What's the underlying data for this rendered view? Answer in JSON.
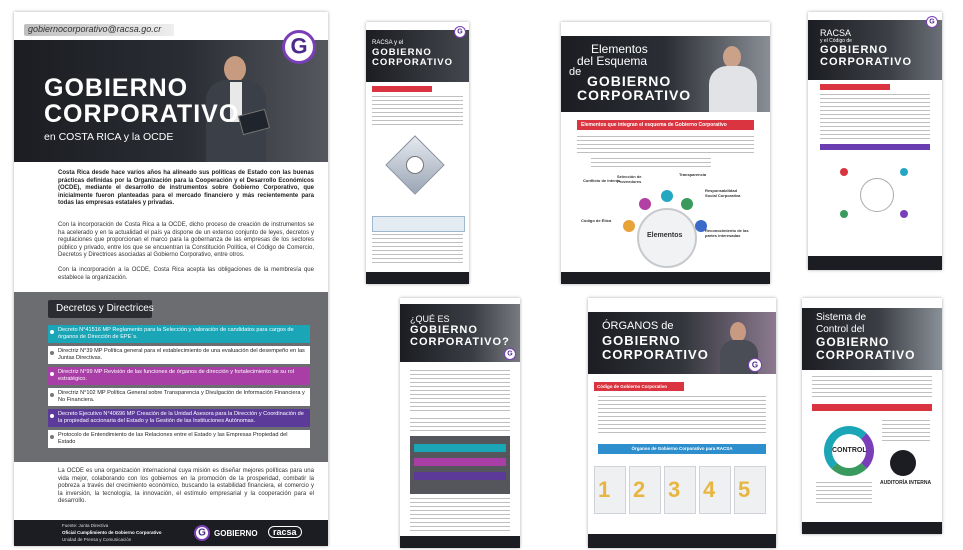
{
  "main_infographic": {
    "email": "gobiernocorporativo@racsa.go.cr",
    "logo_letter": "G",
    "title_line1": "GOBIERNO",
    "title_line2": "CORPORATIVO",
    "subtitle": "en COSTA RICA y la OCDE",
    "intro_bold": "Costa Rica desde hace varios años ha alineado sus políticas de Estado con las buenas prácticas definidas por la Organización para la Cooperación y el Desarrollo Económicos (OCDE), mediante el desarrollo de instrumentos sobre Gobierno Corporativo, que inicialmente fueron planteadas para el mercado financiero y más recientemente para todas las empresas estatales y privadas.",
    "para2": "Con la incorporación de Costa Rica a la OCDE, dicho proceso de creación de instrumentos se ha acelerado y en la actualidad el país ya dispone de un extenso conjunto de leyes, decretos y regulaciones que proporcionan el marco para la gobernanza de las empresas de los sectores público y privado, entre los que se encuentran la Constitución Política, el Código de Comercio, Decretos y Directrices asociadas al Gobierno Corporativo, entre otros.",
    "para3": "Con la incorporación a la OCDE, Costa Rica acepta las obligaciones de la membresía que establece la organización.",
    "section_title": "Decretos y Directrices",
    "decrees": [
      {
        "text": "Decreto N°41516 MP Reglamento para la Selección y valoración de candidatos para cargos de órganos de Dirección de EPE´s.",
        "color": "#1aa6b7"
      },
      {
        "text": "Directriz N°39 MP Política general para el establecimiento de una evaluación del desempeño en las Juntas Directivas.",
        "color": "#ffffff"
      },
      {
        "text": "Directriz N°99 MP Revisión de las funciones de órganos de dirección y fortalecimiento de su rol estratégico.",
        "color": "#a83ea6"
      },
      {
        "text": "Directriz N°102 MP Política General sobre Transparencia y Divulgación de Información Financiera y No Financiera.",
        "color": "#ffffff"
      },
      {
        "text": "Decreto Ejecutivo N°40696 MP Creación de la Unidad Asesora para la Dirección y Coordinación de la propiedad accionaria del Estado y la Gestión de las Instituciones Autónomas.",
        "color": "#5b3a9a"
      },
      {
        "text": "Protocolo de Entendimiento de las Relaciones entre el Estado y las Empresas Propiedad del Estado",
        "color": "#ffffff"
      }
    ],
    "closing": "La OCDE es una organización internacional cuya misión es diseñar mejores políticas para una vida mejor, colaborando con los gobiernos en la promoción de la prosperidad, combatir la pobreza a través del crecimiento económico, buscando la estabilidad financiera, el comercio y la inversión, la tecnología, la innovación, el estímulo empresarial y la cooperación para el desarrollo.",
    "footer_line1": "Fuente: Junta Directiva",
    "footer_line2": "Oficial Cumplimiento de Gobierno Corporativo",
    "footer_line3": "Unidad de Prensa y Comunicación",
    "footer_brand": "GOBIERNO",
    "footer_racsa": "racsa"
  },
  "thumb_racsa_code": {
    "title_small": "RACSA y el",
    "title_line1": "GOBIERNO",
    "title_line2": "CORPORATIVO"
  },
  "thumb_elements": {
    "title_line1": "Elementos",
    "title_line2": "del Esquema",
    "title_line3": "de",
    "title_line4": "GOBIERNO",
    "title_line5": "CORPORATIVO",
    "band": "Elementos que integran el esquema de Gobierno Corporativo",
    "center_label": "Elementos",
    "labels": [
      "Conflicto de interés",
      "Selección de Proveedores",
      "Transparencia",
      "Responsabilidad Social Corporativa",
      "Código de Ética",
      "Reconocimiento de las partes interesadas"
    ]
  },
  "thumb_racsa_code2": {
    "title_line1": "RACSA",
    "title_line2": "y el Código de",
    "title_line3": "GOBIERNO",
    "title_line4": "CORPORATIVO"
  },
  "thumb_que_es": {
    "title_line1": "¿QUÉ ES",
    "title_line2": "GOBIERNO",
    "title_line3": "CORPORATIVO?"
  },
  "thumb_organos": {
    "title_line1": "ÓRGANOS de",
    "title_line2": "GOBIERNO",
    "title_line3": "CORPORATIVO",
    "band": "Código de Gobierno Corporativo",
    "band2": "Órganos de Gobierno Corporativo para RACSA",
    "numbers": [
      "1",
      "2",
      "3",
      "4",
      "5"
    ]
  },
  "thumb_sistema": {
    "title_line1": "Sistema de",
    "title_line2": "Control del",
    "title_line3": "GOBIERNO",
    "title_line4": "CORPORATIVO",
    "center_word": "CONTROL",
    "audit": "AUDITORÍA INTERNA"
  },
  "colors": {
    "dark": "#1b1d22",
    "teal": "#1aa6b7",
    "purple": "#a83ea6",
    "violet": "#5b3a9a",
    "red_band": "#d9343f"
  }
}
